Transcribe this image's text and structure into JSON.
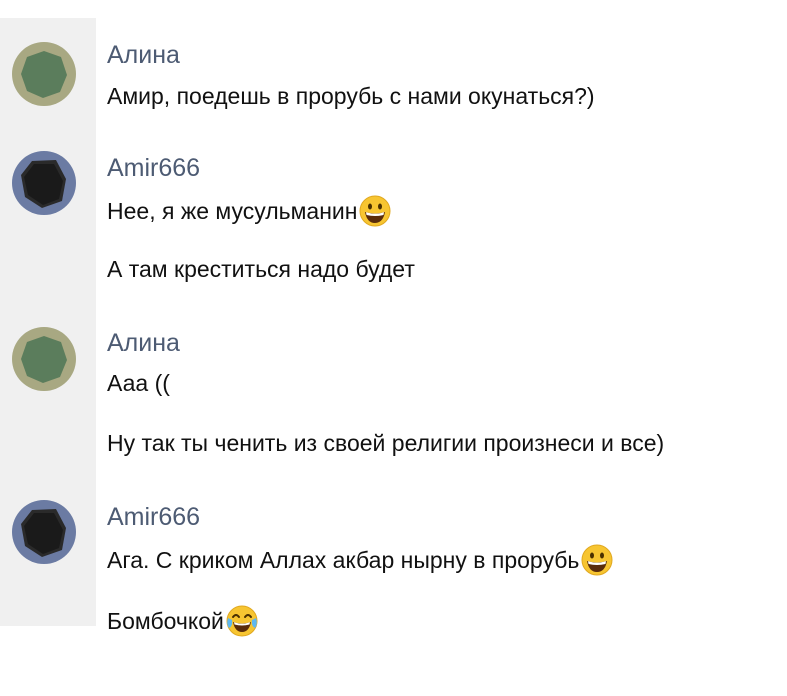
{
  "colors": {
    "name_color": "#4d5b73",
    "text_color": "#111111",
    "strip_bg": "#f0f0f0",
    "avatar_alina_outer": "#a8a882",
    "avatar_alina_inner": "#5b7d5c",
    "avatar_amir_outer": "#6b7ba3",
    "avatar_amir_inner": "#1d1d1d"
  },
  "messages": [
    {
      "author": "Алина",
      "avatar_icon": "avatar-green-icon",
      "lines": [
        "Амир, поедешь в прорубь с нами окунаться?)"
      ]
    },
    {
      "author": "Amir666",
      "avatar_icon": "avatar-dark-icon",
      "lines": [
        "Нее, я же мусульманин",
        "А там креститься надо будет"
      ],
      "emoji": [
        "grinning-face-icon"
      ]
    },
    {
      "author": "Алина",
      "avatar_icon": "avatar-green-icon",
      "lines": [
        "Ааа ((",
        "Ну так ты ченить из своей религии произнеси и все)"
      ]
    },
    {
      "author": "Amir666",
      "avatar_icon": "avatar-dark-icon",
      "lines": [
        "Ага. С криком Аллах акбар нырну в прорубь",
        "Бомбочкой"
      ],
      "emoji": [
        "grinning-face-icon",
        "tears-of-joy-icon"
      ]
    }
  ]
}
